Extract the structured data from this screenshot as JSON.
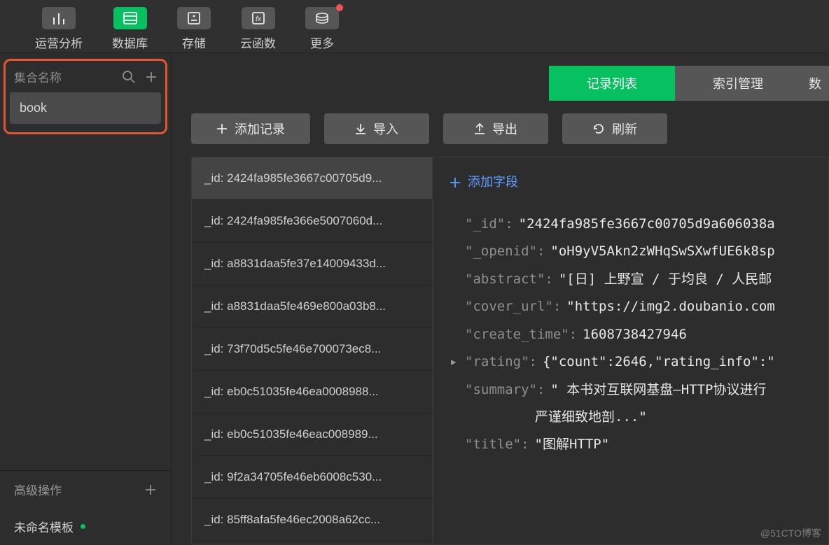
{
  "topnav": [
    {
      "name": "analytics",
      "label": "运营分析",
      "active": false,
      "notif": false
    },
    {
      "name": "database",
      "label": "数据库",
      "active": true,
      "notif": false
    },
    {
      "name": "storage",
      "label": "存储",
      "active": false,
      "notif": false
    },
    {
      "name": "functions",
      "label": "云函数",
      "active": false,
      "notif": false
    },
    {
      "name": "more",
      "label": "更多",
      "active": false,
      "notif": true
    }
  ],
  "sidebar": {
    "collection_label": "集合名称",
    "collections": [
      {
        "name": "book"
      }
    ],
    "advanced_label": "高级操作",
    "template_label": "未命名模板"
  },
  "tabs": {
    "records": "记录列表",
    "indexes": "索引管理",
    "partial": "数"
  },
  "toolbar": {
    "add_record": "添加记录",
    "import": "导入",
    "export": "导出",
    "refresh": "刷新"
  },
  "records": [
    {
      "id": "2424fa985fe3667c00705d9...",
      "selected": true
    },
    {
      "id": "2424fa985fe366e5007060d...",
      "selected": false
    },
    {
      "id": "a8831daa5fe37e14009433d...",
      "selected": false
    },
    {
      "id": "a8831daa5fe469e800a03b8...",
      "selected": false
    },
    {
      "id": "73f70d5c5fe46e700073ec8...",
      "selected": false
    },
    {
      "id": "eb0c51035fe46ea0008988...",
      "selected": false
    },
    {
      "id": "eb0c51035fe46eac008989...",
      "selected": false
    },
    {
      "id": "9f2a34705fe46eb6008c530...",
      "selected": false
    },
    {
      "id": "85ff8afa5fe46ec2008a62cc...",
      "selected": false
    }
  ],
  "record_prefix": "_id: ",
  "detail": {
    "add_field": "添加字段",
    "fields": [
      {
        "key": "_id",
        "value": "\"2424fa985fe3667c00705d9a606038a",
        "expandable": false
      },
      {
        "key": "_openid",
        "value": "\"oH9yV5Akn2zWHqSwSXwfUE6k8sp",
        "expandable": false
      },
      {
        "key": "abstract",
        "value": "\"[日] 上野宣 / 于均良 / 人民邮",
        "expandable": false
      },
      {
        "key": "cover_url",
        "value": "\"https://img2.doubanio.com",
        "expandable": false
      },
      {
        "key": "create_time",
        "value": "1608738427946",
        "expandable": false
      },
      {
        "key": "rating",
        "value": "{\"count\":2646,\"rating_info\":\"",
        "expandable": true
      },
      {
        "key": "summary",
        "value": "\" 本书对互联网基盘—HTTP协议进行",
        "expandable": false,
        "continuation": "严谨细致地剖...\""
      },
      {
        "key": "title",
        "value": "\"图解HTTP\"",
        "expandable": false
      }
    ]
  },
  "watermark": "@51CTO博客"
}
